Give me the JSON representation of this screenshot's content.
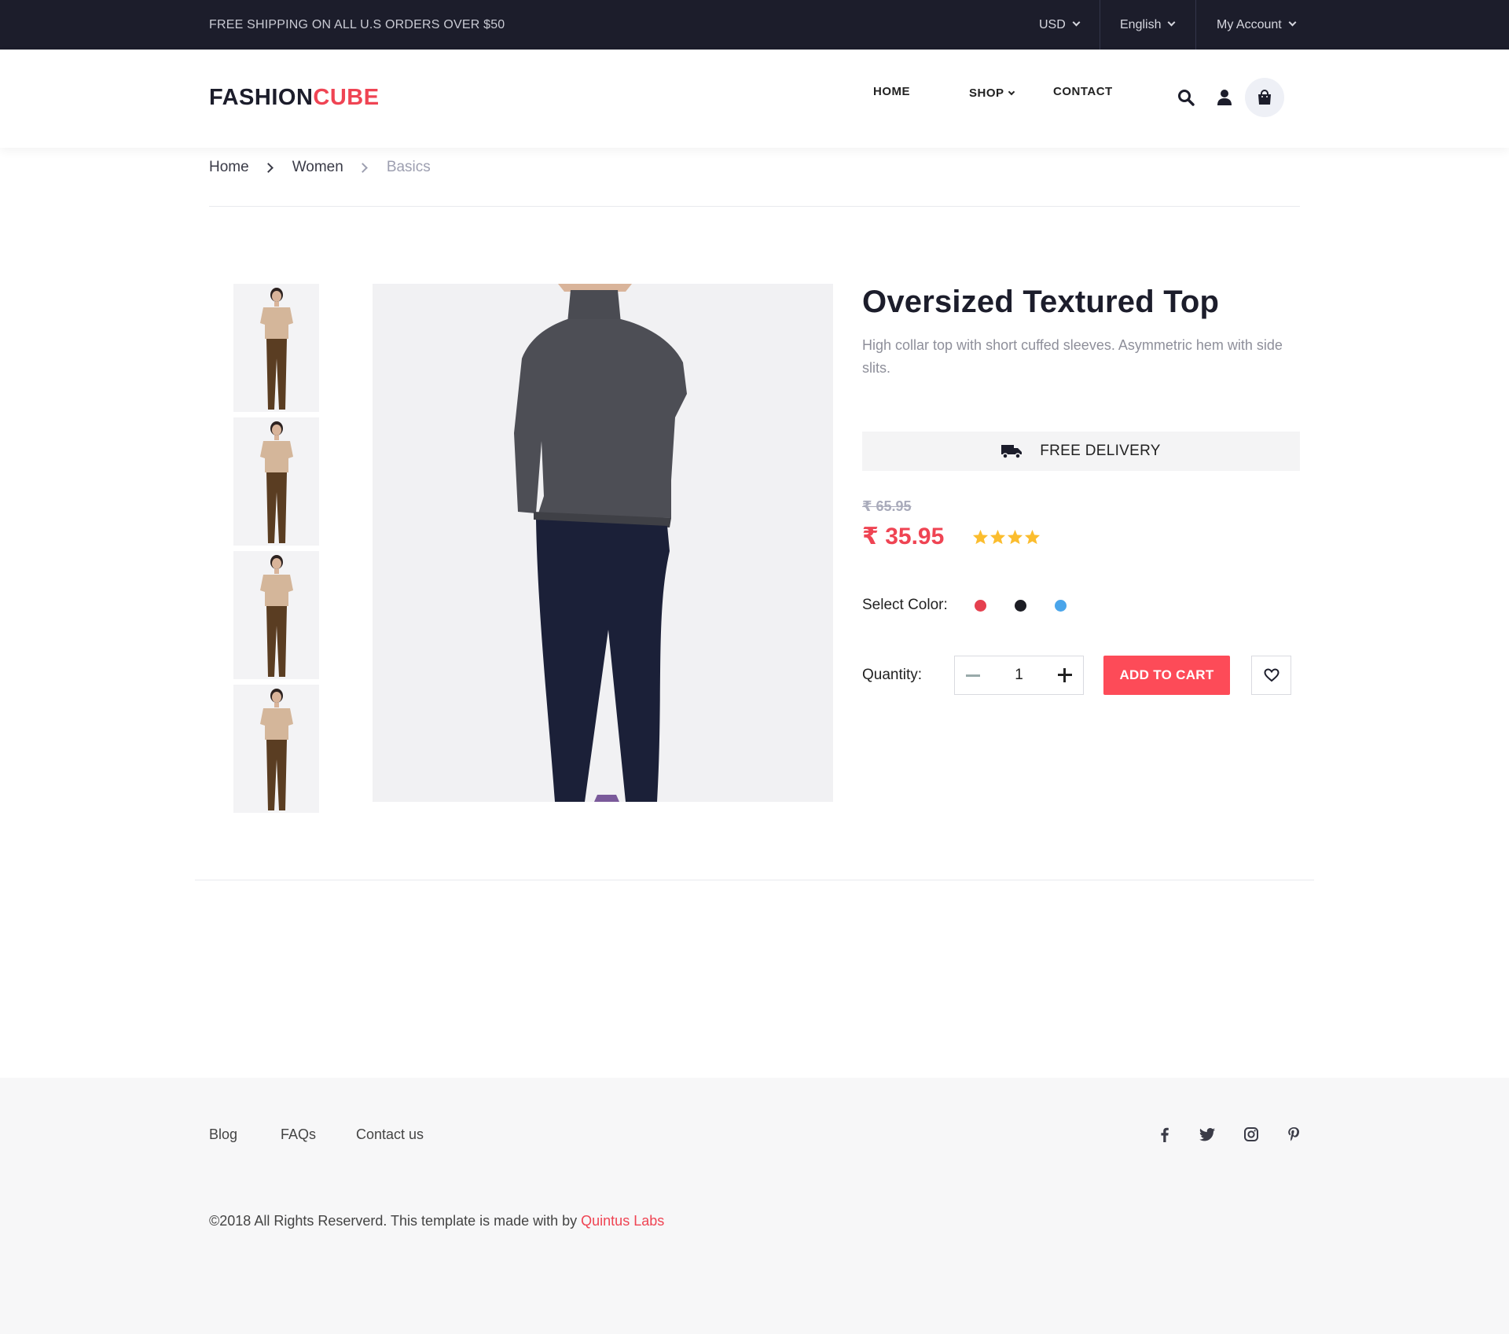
{
  "topbar": {
    "promo": "FREE SHIPPING ON ALL U.S ORDERS OVER $50",
    "currency": "USD",
    "language": "English",
    "account": "My Account"
  },
  "header": {
    "logo_main": "FASHION",
    "logo_accent": "CUBE",
    "nav": {
      "home": "HOME",
      "shop": "SHOP",
      "contact": "CONTACT"
    }
  },
  "breadcrumb": {
    "items": [
      "Home",
      "Women",
      "Basics"
    ]
  },
  "product": {
    "title": "Oversized Textured Top",
    "description": "High collar top with short cuffed sleeves. Asymmetric hem with side slits.",
    "delivery": "FREE DELIVERY",
    "old_price": "₹ 65.95",
    "price": "₹ 35.95",
    "rating": 4,
    "color_label": "Select Color:",
    "colors": [
      "#e5404f",
      "#1c1d24",
      "#4aa5ea"
    ],
    "quantity_label": "Quantity:",
    "quantity": "1",
    "add_to_cart": "ADD TO CART"
  },
  "footer": {
    "links": [
      "Blog",
      "FAQs",
      "Contact us"
    ],
    "social": [
      "facebook-icon",
      "twitter-icon",
      "instagram-icon",
      "pinterest-icon"
    ],
    "copyright_text": "©2018 All Rights Reserverd. This template is made with  by ",
    "copyright_brand": "Quintus Labs"
  },
  "colors": {
    "accent": "#ef4453",
    "topbar_bg": "#1c1d2b",
    "button": "#fd4b58"
  }
}
